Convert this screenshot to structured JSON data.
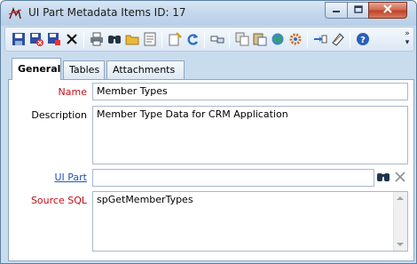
{
  "window": {
    "title": "UI Part Metadata Items ID: 17"
  },
  "toolbar": {
    "icons": [
      "save-icon",
      "save-close-icon",
      "save-new-icon",
      "delete-icon",
      "print-icon",
      "find-icon",
      "open-folder-icon",
      "notes-icon",
      "wizard-icon",
      "refresh-icon",
      "link-icon",
      "copy-icon",
      "paste-icon",
      "globe-icon",
      "settings-icon",
      "import-icon",
      "export-icon",
      "help-icon"
    ]
  },
  "tabs": [
    {
      "label": "General",
      "active": true
    },
    {
      "label": "Tables",
      "active": false
    },
    {
      "label": "Attachments",
      "active": false
    }
  ],
  "form": {
    "name_label": "Name",
    "name_value": "Member Types",
    "description_label": "Description",
    "description_value": "Member Type Data for CRM Application",
    "uipart_label": "UI Part",
    "uipart_value": "",
    "sourcesql_label": "Source SQL",
    "sourcesql_value": "spGetMemberTypes"
  },
  "colors": {
    "required_label": "#c0101a",
    "link_label": "#1f56b8",
    "window_bg": "#c9dcee"
  }
}
